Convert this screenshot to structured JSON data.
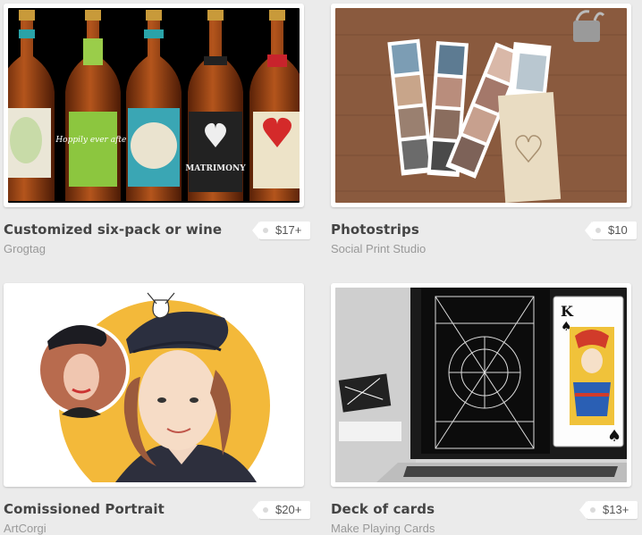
{
  "products": [
    {
      "title": "Customized six-pack or wine",
      "maker": "Grogtag",
      "price": "$17+"
    },
    {
      "title": "Photostrips",
      "maker": "Social Print Studio",
      "price": "$10"
    },
    {
      "title": "Comissioned Portrait",
      "maker": "ArtCorgi",
      "price": "$20+"
    },
    {
      "title": "Deck of cards",
      "maker": "Make Playing Cards",
      "price": "$13+"
    }
  ],
  "bottles": [
    {
      "text": "Hoppily ever after",
      "label_color": "#8cc63f"
    },
    {
      "text": "MATRIMONY",
      "label_color": "#222222"
    }
  ],
  "card_face": {
    "rank": "K",
    "suit": "♠"
  },
  "colors": {
    "background": "#ebebeb",
    "portrait_circle": "#f3b93a",
    "wood": "#8a5a3e"
  }
}
